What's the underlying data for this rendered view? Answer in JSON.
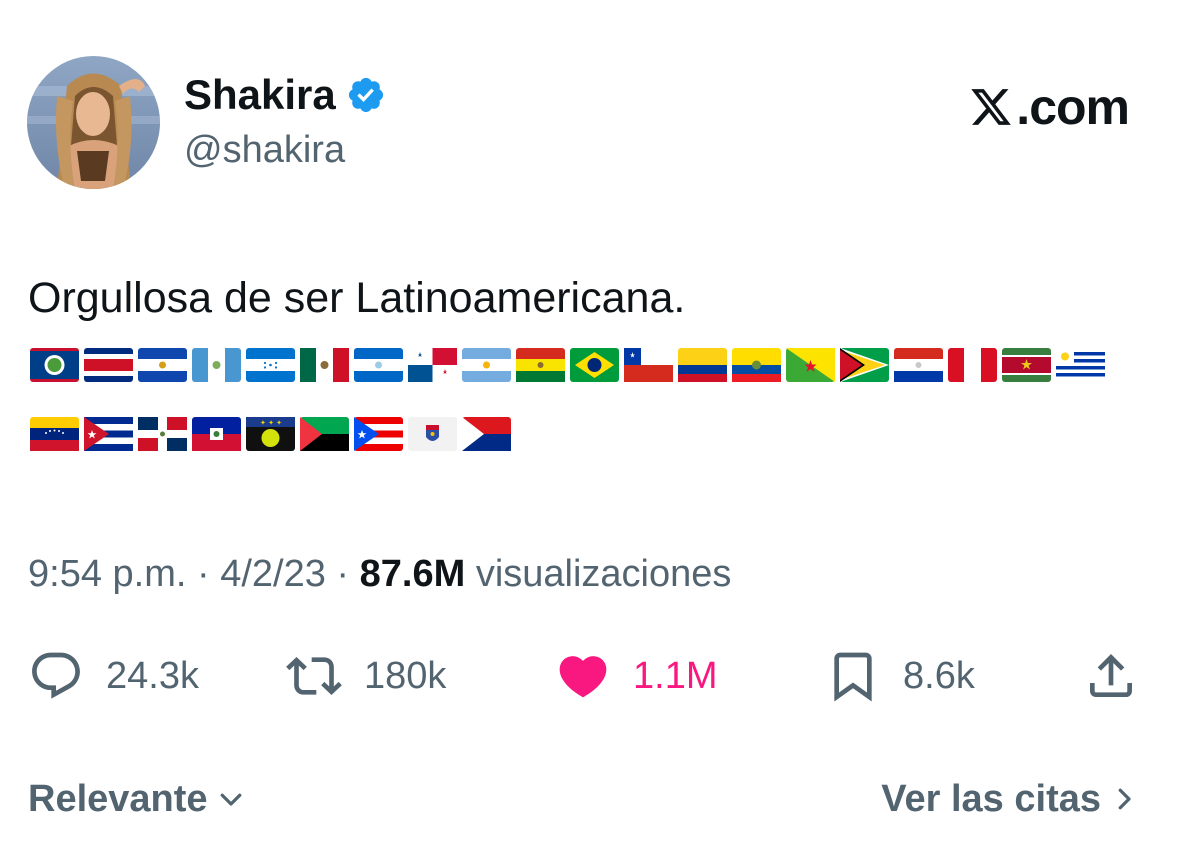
{
  "user": {
    "display_name": "Shakira",
    "handle": "@shakira",
    "verified": true
  },
  "brand": {
    "text": ".com",
    "icon": "x-logo-icon"
  },
  "tweet": {
    "text": "Orgullosa de ser Latinoamericana.",
    "flags_row1": [
      "Belize",
      "Costa Rica",
      "El Salvador",
      "Guatemala",
      "Honduras",
      "Mexico",
      "Nicaragua",
      "Panama",
      "Argentina",
      "Bolivia",
      "Brazil",
      "Chile",
      "Colombia",
      "Ecuador",
      "French Guiana",
      "Guyana",
      "Paraguay",
      "Peru",
      "Suriname",
      "Uruguay"
    ],
    "flags_row2": [
      "Venezuela",
      "Cuba",
      "Dominican Republic",
      "Haiti",
      "Guadeloupe",
      "Martinique",
      "Puerto Rico",
      "Saint Barthélemy",
      "Saint Martin"
    ]
  },
  "meta": {
    "time": "9:54 p.m.",
    "sep1": " · ",
    "date": "4/2/23",
    "sep2": " · ",
    "views_count": "87.6M",
    "views_label": " visualizaciones"
  },
  "actions": {
    "replies": "24.3k",
    "retweets": "180k",
    "likes": "1.1M",
    "bookmarks": "8.6k"
  },
  "footer": {
    "sort_label": "Relevante",
    "quotes_label": "Ver las citas"
  },
  "colors": {
    "like": "#f91880",
    "verified": "#1d9bf0",
    "secondary_text": "#536471"
  }
}
